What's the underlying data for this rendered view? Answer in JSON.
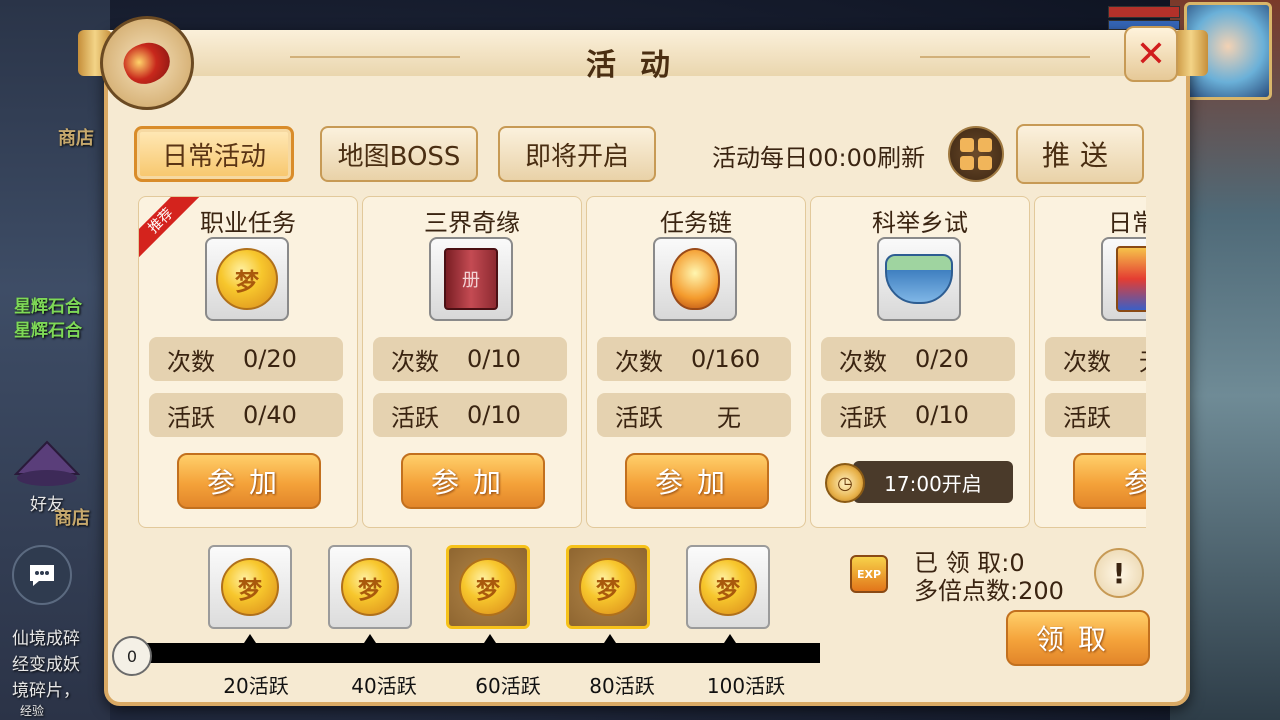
{
  "background": {
    "shop_label": "商店",
    "shop_label_2": "商店",
    "friend_label": "好友",
    "green_text_1": "星辉石合",
    "green_text_2": "星辉石合",
    "chat_lines": [
      "仙境成碎",
      "经变成妖",
      "境碎片，"
    ],
    "exp_bottom": "经验"
  },
  "dialog": {
    "title": "活动"
  },
  "tabs": [
    {
      "label": "日常活动",
      "active": true
    },
    {
      "label": "地图BOSS",
      "active": false
    },
    {
      "label": "即将开启",
      "active": false
    }
  ],
  "header": {
    "refresh_text": "活动每日00:00刷新",
    "push_label": "推送"
  },
  "activities": [
    {
      "name": "职业任务",
      "icon": "gold-coin-icon",
      "recommended": true,
      "recommend_label": "推荐",
      "count_label": "次数",
      "count_value": "0/20",
      "active_label": "活跃",
      "active_value": "0/40",
      "action": "join",
      "join_label": "参加"
    },
    {
      "name": "三界奇缘",
      "icon": "red-book-icon",
      "recommended": false,
      "count_label": "次数",
      "count_value": "0/10",
      "active_label": "活跃",
      "active_value": "0/10",
      "action": "join",
      "join_label": "参加"
    },
    {
      "name": "任务链",
      "icon": "lantern-icon",
      "recommended": false,
      "count_label": "次数",
      "count_value": "0/160",
      "active_label": "活跃",
      "active_value": "无",
      "action": "join",
      "join_label": "参加"
    },
    {
      "name": "科举乡试",
      "icon": "porcelain-bowl-icon",
      "recommended": false,
      "count_label": "次数",
      "count_value": "0/20",
      "active_label": "活跃",
      "active_value": "0/10",
      "action": "timer",
      "timer_label": "17:00开启"
    },
    {
      "name": "日常副",
      "icon": "poster-icon",
      "recommended": false,
      "count_label": "次数",
      "count_value": "无",
      "active_label": "活跃",
      "active_value": "",
      "action": "join",
      "join_label": "参"
    }
  ],
  "rewards": {
    "milestones": [
      {
        "label": "20活跃",
        "highlighted": false
      },
      {
        "label": "40活跃",
        "highlighted": false
      },
      {
        "label": "60活跃",
        "highlighted": true
      },
      {
        "label": "80活跃",
        "highlighted": true
      },
      {
        "label": "100活跃",
        "highlighted": false
      }
    ],
    "current_active": "0",
    "progress_fraction": 0,
    "claimed_text": "已 领 取:0",
    "multi_points_text": "多倍点数:200",
    "exp_icon_text": "EXP",
    "claim_label": "领取"
  },
  "colors": {
    "accent_orange": "#f4a23a",
    "highlight_gold": "#f6c21a",
    "close_red": "#d11d1d",
    "panel_bg": "#f6ead2"
  }
}
